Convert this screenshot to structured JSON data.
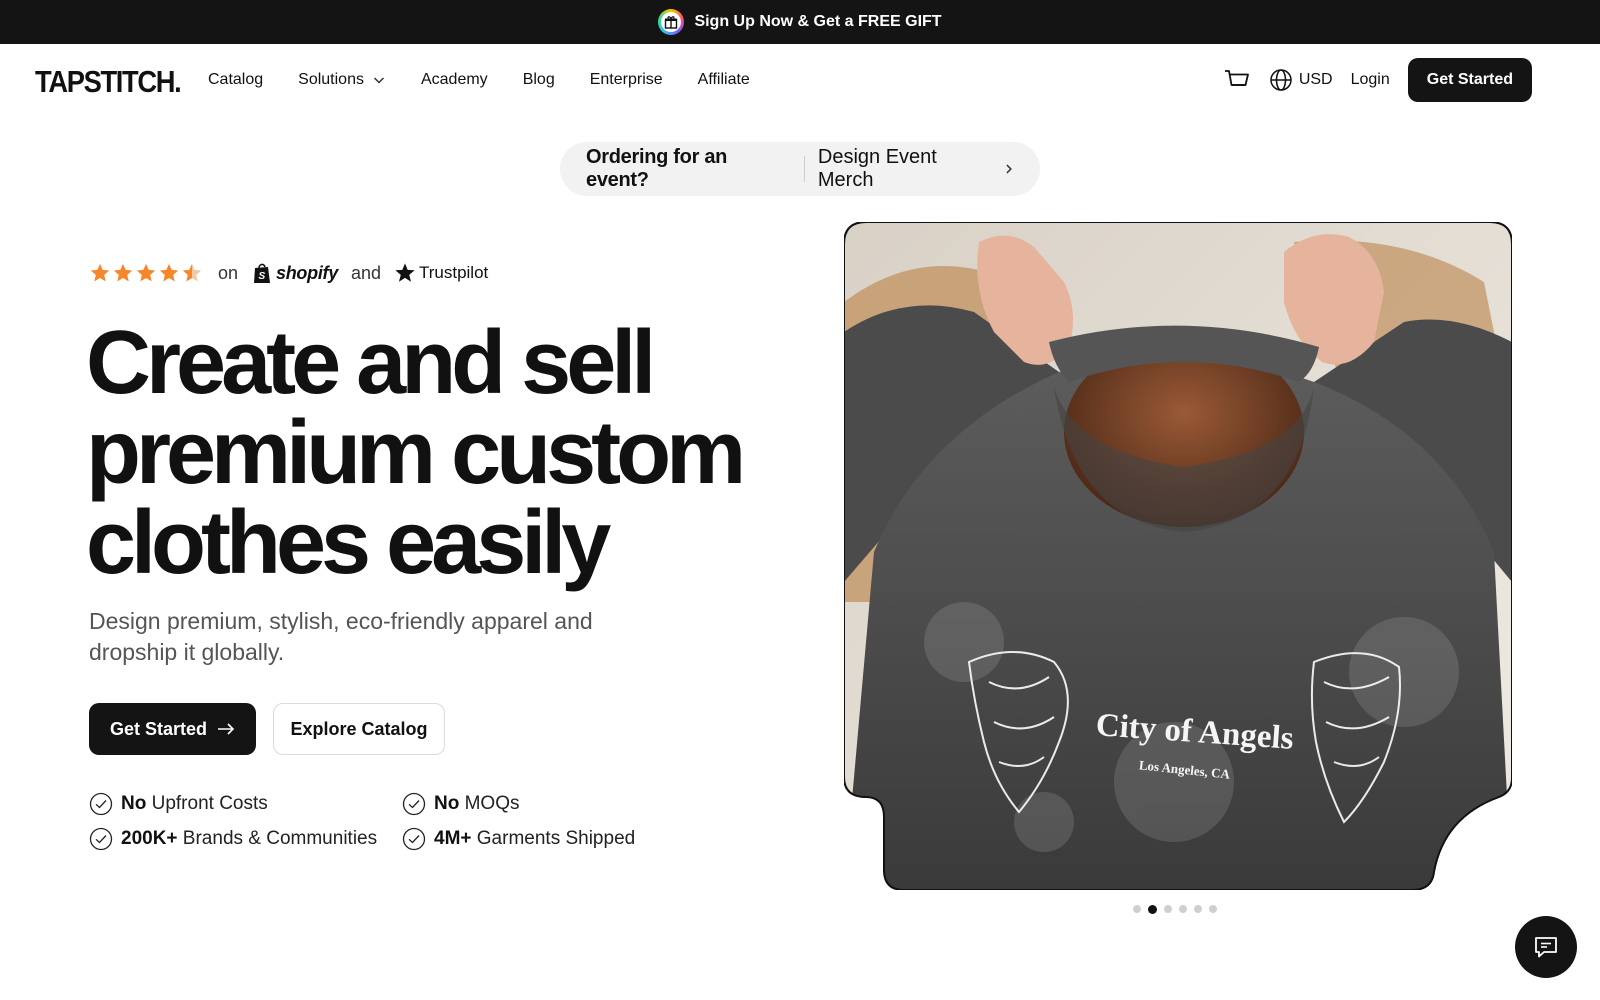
{
  "announcement": {
    "text": "Sign Up Now & Get a FREE GIFT",
    "icon": "gift-icon"
  },
  "brand": {
    "logo_text": "TAPSTITCH."
  },
  "nav": {
    "links": [
      {
        "label": "Catalog"
      },
      {
        "label": "Solutions",
        "has_dropdown": true
      },
      {
        "label": "Academy"
      },
      {
        "label": "Blog"
      },
      {
        "label": "Enterprise"
      },
      {
        "label": "Affiliate"
      }
    ],
    "currency": "USD",
    "login": "Login",
    "cta": "Get Started"
  },
  "event_pill": {
    "question": "Ordering for an event?",
    "link": "Design Event Merch"
  },
  "ratings": {
    "stars": 4.5,
    "on_text": "on",
    "shopify": "shopify",
    "and_text": "and",
    "trustpilot": "Trustpilot",
    "star_color": "#f7862a"
  },
  "hero": {
    "headline_lines": [
      "Create and sell",
      "premium custom",
      "clothes easily"
    ],
    "subtext": "Design premium, stylish, eco-friendly apparel and dropship it globally.",
    "primary_cta": "Get Started",
    "secondary_cta": "Explore Catalog",
    "features": [
      {
        "bold": "No",
        "text": " Upfront Costs"
      },
      {
        "bold": "No",
        "text": " MOQs"
      },
      {
        "bold": "200K+",
        "text": " Brands & Communities"
      },
      {
        "bold": "4M+",
        "text": " Garments Shipped"
      }
    ],
    "image": {
      "shirt_text": "City of Angels",
      "shirt_subtext": "Los Angeles, CA"
    },
    "carousel": {
      "total": 6,
      "active_index": 1
    }
  },
  "colors": {
    "dark": "#141414",
    "accent_star": "#f7862a"
  }
}
